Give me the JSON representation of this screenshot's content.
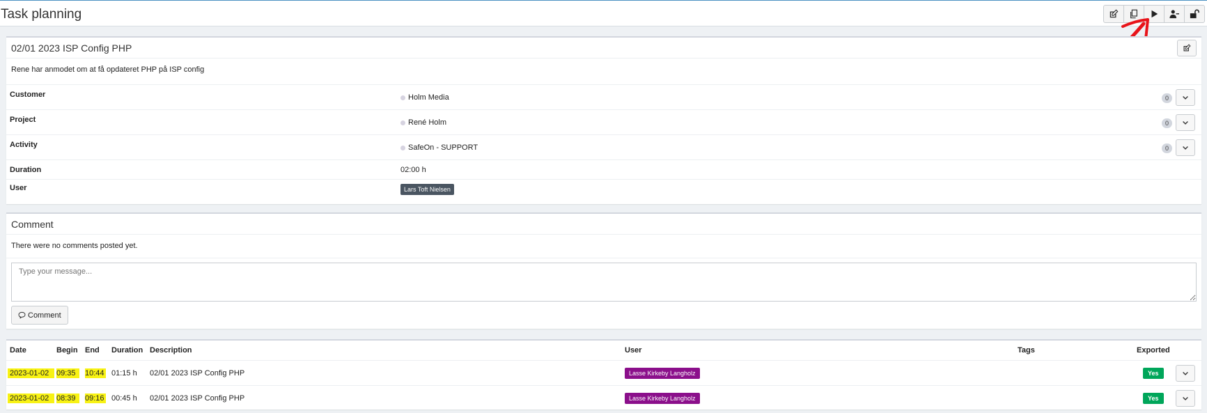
{
  "page": {
    "title": "Task planning"
  },
  "toolbar": [
    {
      "icon": "edit-icon",
      "name": "edit-button"
    },
    {
      "icon": "copy-icon",
      "name": "copy-button"
    },
    {
      "icon": "play-icon",
      "name": "start-button"
    },
    {
      "icon": "user-minus-icon",
      "name": "unassign-user-button"
    },
    {
      "icon": "unlock-icon",
      "name": "unlock-button"
    }
  ],
  "task": {
    "title": "02/01 2023 ISP Config PHP",
    "description": "Rene har anmodet om at få opdateret PHP på ISP config",
    "rows": [
      {
        "label": "Customer",
        "value": "Holm Media",
        "count": "0"
      },
      {
        "label": "Project",
        "value": "René Holm",
        "count": "0"
      },
      {
        "label": "Activity",
        "value": "SafeOn - SUPPORT",
        "count": "0"
      }
    ],
    "duration_label": "Duration",
    "duration_value": "02:00 h",
    "user_label": "User",
    "user_value": "Lars Toft Nielsen"
  },
  "comment": {
    "title": "Comment",
    "empty_text": "There were no comments posted yet.",
    "placeholder": "Type your message...",
    "button_label": "Comment",
    "button_icon": "speech-bubble-icon"
  },
  "timesheet": {
    "columns": [
      "Date",
      "Begin",
      "End",
      "Duration",
      "Description",
      "User",
      "Tags",
      "Exported"
    ],
    "rows": [
      {
        "date": "2023-01-02",
        "begin": "09:35",
        "end": "10:44",
        "duration": "01:15 h",
        "description": "02/01 2023 ISP Config PHP",
        "user": "Lasse Kirkeby Langholz",
        "tags": "",
        "exported": "Yes"
      },
      {
        "date": "2023-01-02",
        "begin": "08:39",
        "end": "09:16",
        "duration": "00:45 h",
        "description": "02/01 2023 ISP Config PHP",
        "user": "Lasse Kirkeby Langholz",
        "tags": "",
        "exported": "Yes"
      }
    ]
  },
  "colors": {
    "highlight": "#f8f214",
    "user_badge": "#8b0f8b",
    "exported_badge": "#00a65a",
    "annotation_arrow": "#e8141a"
  }
}
